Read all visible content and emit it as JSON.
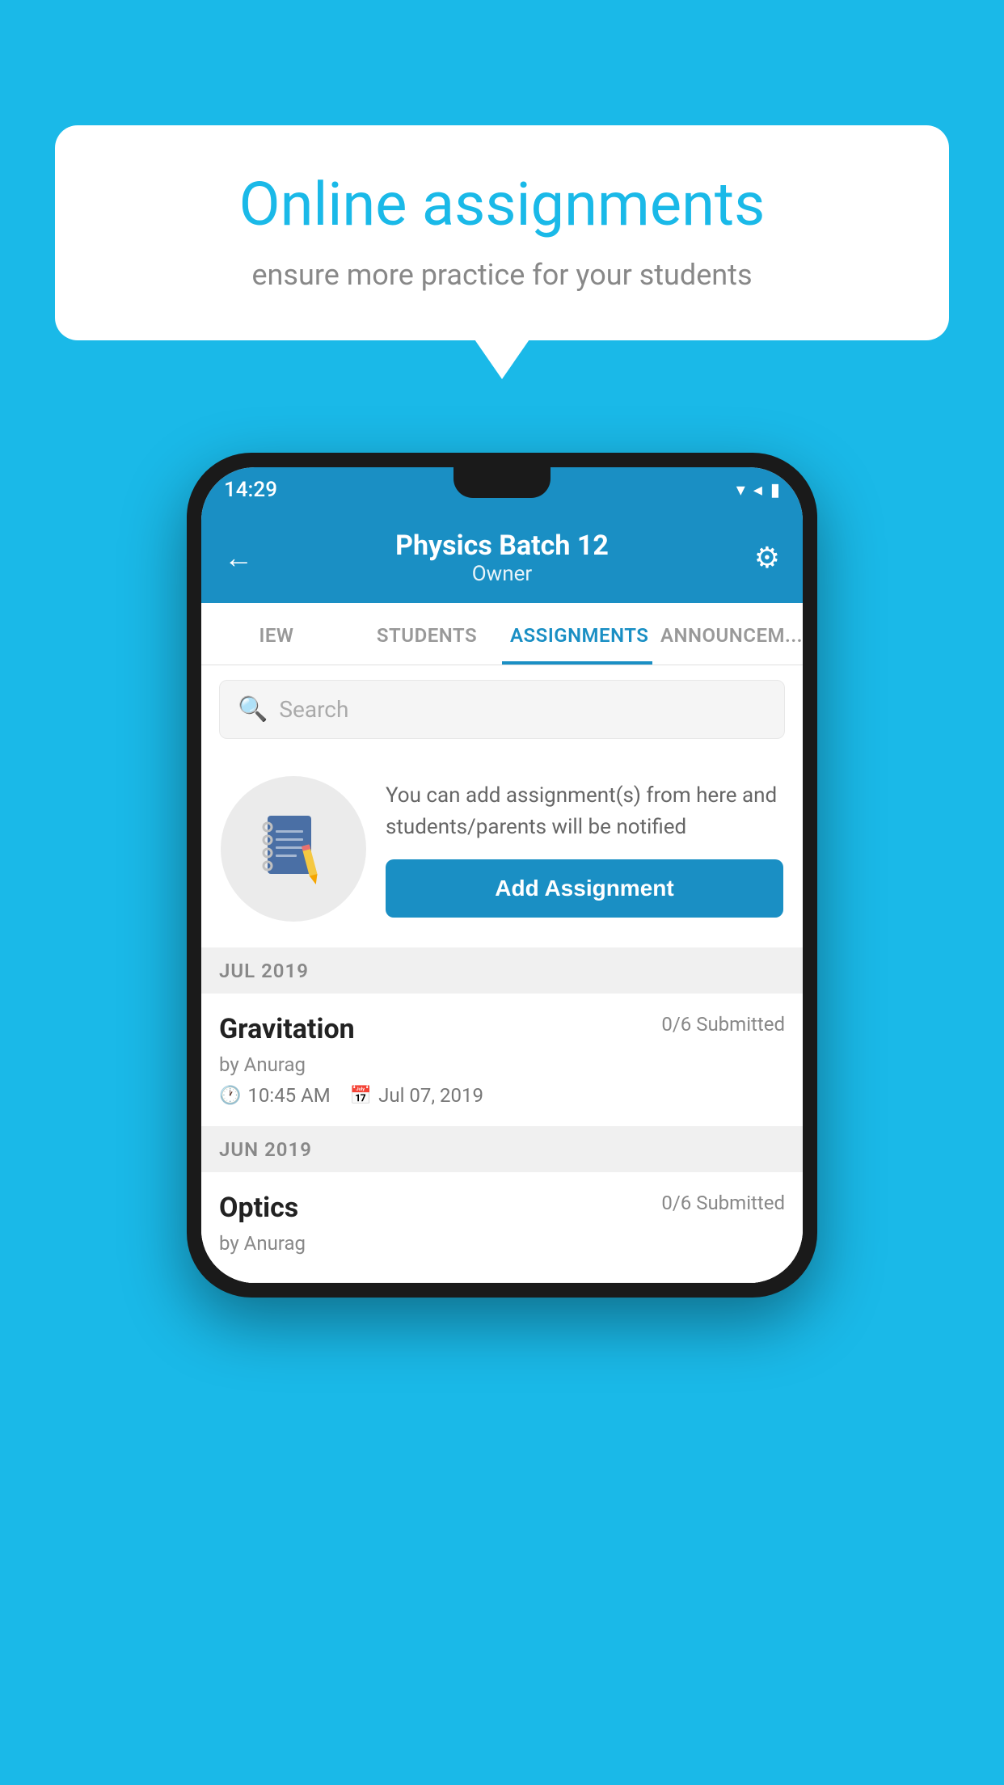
{
  "background_color": "#1ab9e8",
  "speech_bubble": {
    "title": "Online assignments",
    "subtitle": "ensure more practice for your students"
  },
  "phone": {
    "status_bar": {
      "time": "14:29",
      "icons": [
        "wifi",
        "signal",
        "battery"
      ]
    },
    "app_bar": {
      "title": "Physics Batch 12",
      "subtitle": "Owner",
      "back_label": "←",
      "settings_label": "⚙"
    },
    "tabs": [
      {
        "label": "IEW",
        "active": false
      },
      {
        "label": "STUDENTS",
        "active": false
      },
      {
        "label": "ASSIGNMENTS",
        "active": true
      },
      {
        "label": "ANNOUNCEM...",
        "active": false
      }
    ],
    "search": {
      "placeholder": "Search"
    },
    "promo": {
      "description": "You can add assignment(s) from here and students/parents will be notified",
      "button_label": "Add Assignment"
    },
    "assignments": [
      {
        "month": "JUL 2019",
        "items": [
          {
            "title": "Gravitation",
            "submitted": "0/6 Submitted",
            "author": "by Anurag",
            "time": "10:45 AM",
            "date": "Jul 07, 2019"
          }
        ]
      },
      {
        "month": "JUN 2019",
        "items": [
          {
            "title": "Optics",
            "submitted": "0/6 Submitted",
            "author": "by Anurag",
            "time": "",
            "date": ""
          }
        ]
      }
    ]
  }
}
